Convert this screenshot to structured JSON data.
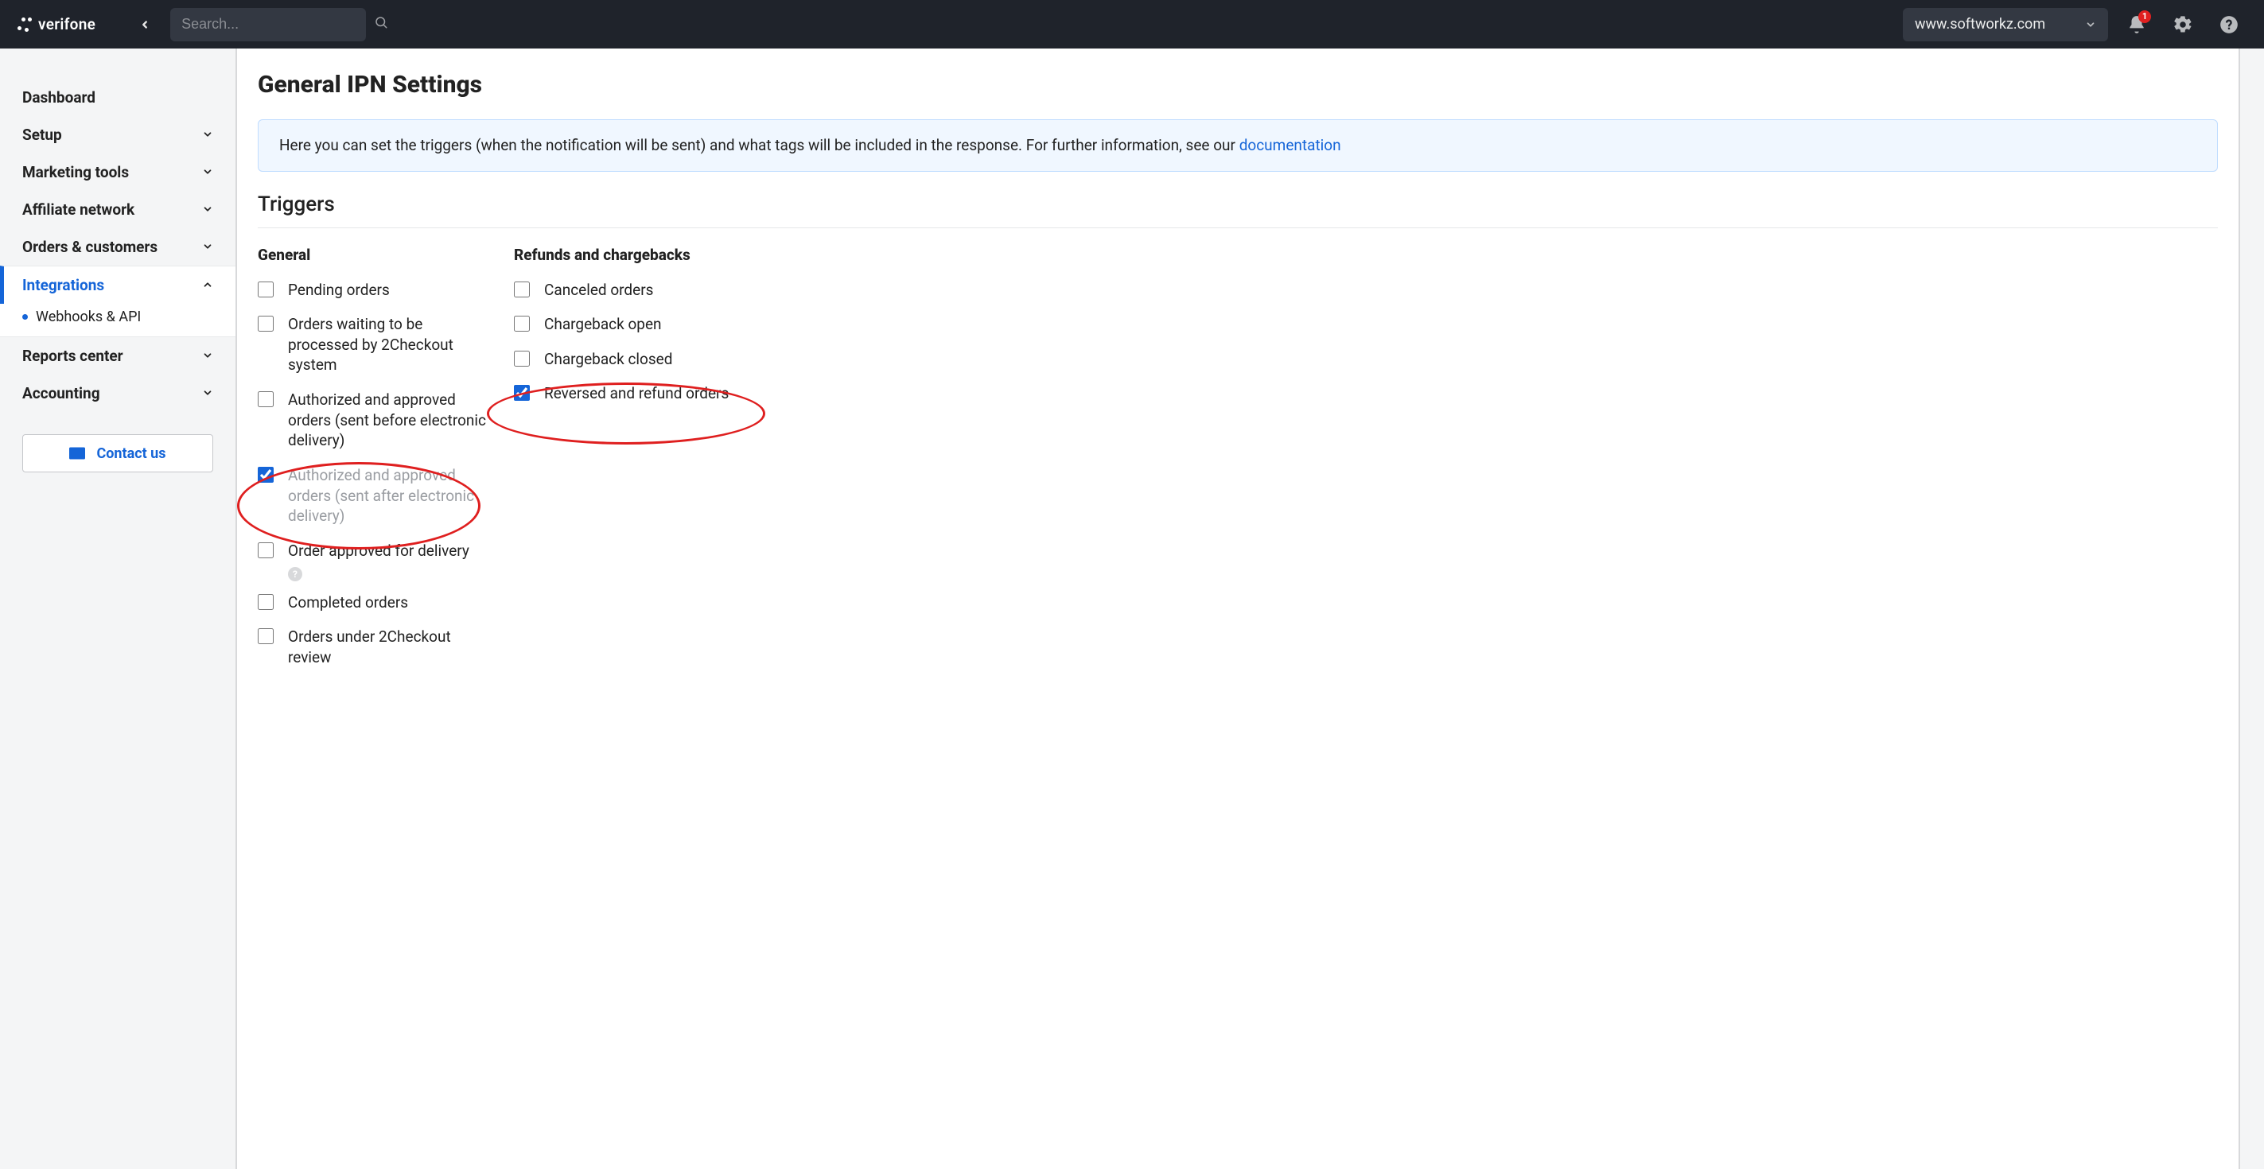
{
  "brand": "verifone",
  "search": {
    "placeholder": "Search..."
  },
  "domain_selected": "www.softworkz.com",
  "notification_count": "1",
  "sidebar": {
    "items": [
      {
        "label": "Dashboard",
        "expandable": false
      },
      {
        "label": "Setup",
        "expandable": true
      },
      {
        "label": "Marketing tools",
        "expandable": true
      },
      {
        "label": "Affiliate network",
        "expandable": true
      },
      {
        "label": "Orders & customers",
        "expandable": true
      },
      {
        "label": "Integrations",
        "expandable": true
      },
      {
        "label": "Reports center",
        "expandable": true
      },
      {
        "label": "Accounting",
        "expandable": true
      }
    ],
    "active_sub": "Webhooks & API",
    "contact_label": "Contact us"
  },
  "page": {
    "title": "General IPN Settings",
    "info_pre": "Here you can set the triggers (when the notification will be sent) and what tags will be included in the response. For further information, see our ",
    "info_link": "documentation",
    "section_triggers": "Triggers",
    "col_general": "General",
    "col_refunds": "Refunds and chargebacks",
    "general_triggers": [
      {
        "label": "Pending orders",
        "checked": false
      },
      {
        "label": "Orders waiting to be processed by 2Checkout system",
        "checked": false
      },
      {
        "label": "Authorized and approved orders (sent before electronic delivery)",
        "checked": false
      },
      {
        "label": "Authorized and approved orders (sent after electronic delivery)",
        "checked": true,
        "dim": true
      },
      {
        "label": "Order approved for delivery",
        "checked": false,
        "help": true
      },
      {
        "label": "Completed orders",
        "checked": false
      },
      {
        "label": "Orders under 2Checkout review",
        "checked": false
      }
    ],
    "refund_triggers": [
      {
        "label": "Canceled orders",
        "checked": false
      },
      {
        "label": "Chargeback open",
        "checked": false
      },
      {
        "label": "Chargeback closed",
        "checked": false
      },
      {
        "label": "Reversed and refund orders",
        "checked": true
      }
    ]
  }
}
